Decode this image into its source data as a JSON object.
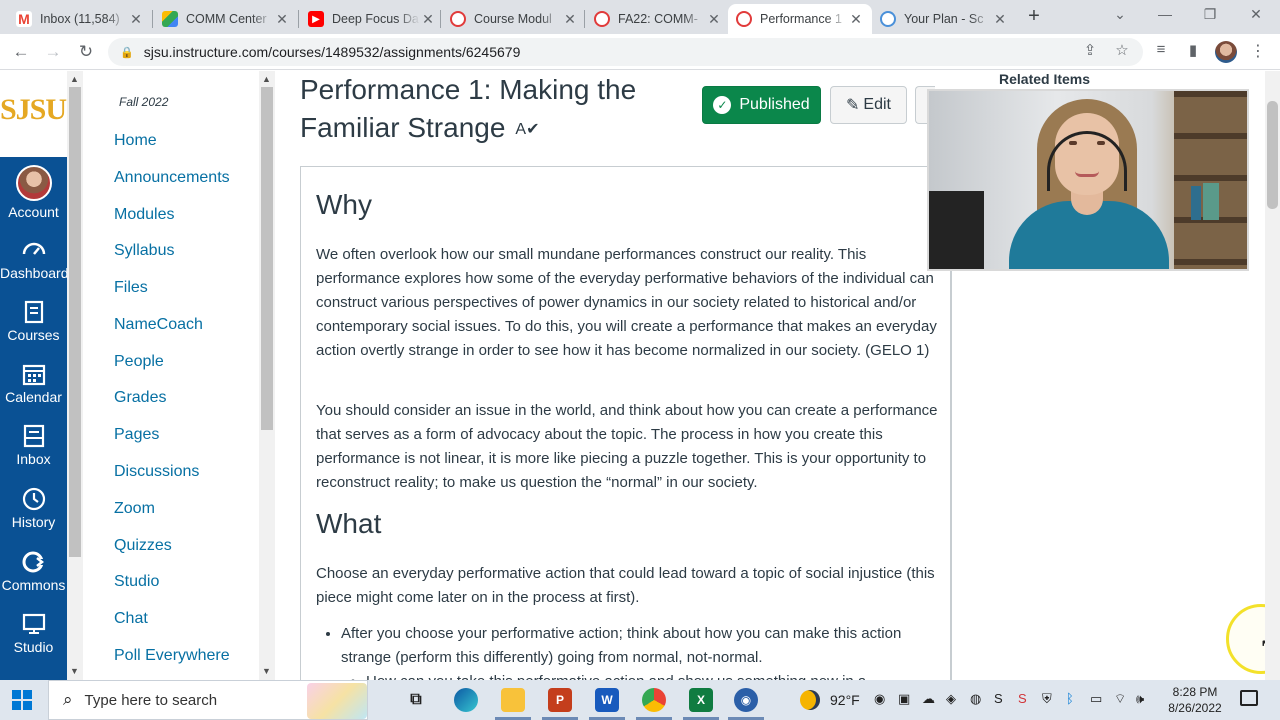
{
  "browser": {
    "tabs": [
      {
        "title": "Inbox (11,584)",
        "icon": "gmail-icon",
        "color": "#ea4335"
      },
      {
        "title": "COMM Center",
        "icon": "google-drive-icon",
        "color": "#34a853"
      },
      {
        "title": "Deep Focus Da",
        "icon": "youtube-icon",
        "color": "#ff0000"
      },
      {
        "title": "Course Modul",
        "icon": "canvas-icon",
        "color": "#e13b3b"
      },
      {
        "title": "FA22: COMM-",
        "icon": "canvas-icon",
        "color": "#e13b3b"
      },
      {
        "title": "Performance 1",
        "icon": "canvas-icon",
        "color": "#e13b3b"
      },
      {
        "title": "Your Plan - Sc",
        "icon": "screencast-icon",
        "color": "#4a90d9"
      }
    ],
    "url": "sjsu.instructure.com/courses/1489532/assignments/6245679"
  },
  "global_nav": {
    "logo": "SJSU",
    "items": [
      {
        "label": "Account",
        "icon": "account-avatar"
      },
      {
        "label": "Dashboard",
        "icon": "dashboard-icon"
      },
      {
        "label": "Courses",
        "icon": "courses-icon"
      },
      {
        "label": "Calendar",
        "icon": "calendar-icon"
      },
      {
        "label": "Inbox",
        "icon": "inbox-icon"
      },
      {
        "label": "History",
        "icon": "history-icon"
      },
      {
        "label": "Commons",
        "icon": "commons-icon"
      },
      {
        "label": "Studio",
        "icon": "studio-icon"
      }
    ]
  },
  "course_nav": {
    "term": "Fall 2022",
    "links": [
      "Home",
      "Announcements",
      "Modules",
      "Syllabus",
      "Files",
      "NameCoach",
      "People",
      "Grades",
      "Pages",
      "Discussions",
      "Zoom",
      "Quizzes",
      "Studio",
      "Chat",
      "Poll Everywhere"
    ]
  },
  "assignment": {
    "title": "Performance 1: Making the Familiar Strange",
    "published_label": "Published",
    "edit_label": "Edit",
    "related_heading": "Related Items",
    "why_heading": "Why",
    "why_p1": "We often overlook how our small mundane performances construct our reality. This performance explores how some of the everyday performative behaviors of the individual can construct various perspectives of power dynamics in our society related to historical and/or contemporary social issues. To do this, you will create a performance that makes an everyday action overtly strange in order to see how it has become normalized in our society. (GELO 1)",
    "why_p2": "You should consider an issue in the world, and think about how you can create a performance that serves as a form of advocacy about the topic. The process in how you create this performance is not linear, it is more like piecing a puzzle together. This is your opportunity to reconstruct reality; to make us question the “normal” in our society.",
    "what_heading": "What",
    "what_p1": "Choose an everyday performative action that could lead toward a topic of social injustice (this piece might come later on in the process at first).",
    "what_bullet1": "After you choose your performative action; think about how you can make this action strange (perform this differently) going from normal, not-normal.",
    "what_bullet2": "How can you take this performative action and show us something new in a"
  },
  "taskbar": {
    "search_placeholder": "Type here to search",
    "weather": "92°F",
    "time": "8:28 PM",
    "date": "8/26/2022"
  }
}
